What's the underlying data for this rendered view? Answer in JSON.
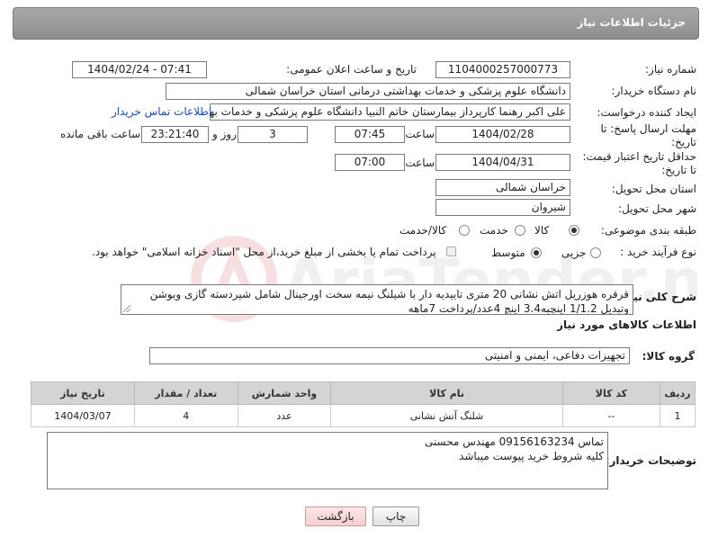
{
  "header": {
    "title": "جزئیات اطلاعات نیاز"
  },
  "form": {
    "need_number_label": "شماره نیاز:",
    "need_number": "1104000257000773",
    "announce_label": "تاریخ و ساعت اعلان عمومی:",
    "announce_value": "1404/02/24 - 07:41",
    "buyer_label": "نام دستگاه خریدار:",
    "buyer_value": "دانشگاه علوم پزشکی و خدمات بهداشتی درمانی استان خراسان شمالی",
    "creator_label": "ایجاد کننده درخواست:",
    "creator_value": "علی اکبر رهنما کارپرداز بیمارستان خاتم النبیا دانشگاه علوم پزشکی و خدمات بهداشتی",
    "contact_link": "اطلاعات تماس خریدار",
    "deadline_label_line1": "مهلت ارسال پاسخ: تا",
    "deadline_label_line2": "تاریخ:",
    "deadline_date": "1404/02/28",
    "time_label": "ساعت",
    "deadline_time": "07:45",
    "days_value": "3",
    "days_label": "روز و",
    "remaining_time": "23:21:40",
    "remaining_label": "ساعت باقی مانده",
    "validity_label_line1": "حداقل تاریخ اعتبار قیمت:",
    "validity_label_line2": "تا تاریخ:",
    "validity_date": "1404/04/31",
    "validity_time_label": "ساعت",
    "validity_time": "07:00",
    "province_label": "استان محل تحویل:",
    "province_value": "خراسان شمالی",
    "city_label": "شهر محل تحویل:",
    "city_value": "شیروان",
    "category_label": "طبقه بندی موضوعی:",
    "category_options": [
      "کالا",
      "خدمت",
      "کالا/خدمت"
    ],
    "category_selected": "کالا",
    "process_label": "نوع فرآیند خرید :",
    "process_options": [
      "جزیی",
      "متوسط"
    ],
    "process_selected": "متوسط",
    "payment_note": "پرداخت تمام یا بخشی از مبلغ خرید،از محل \"اسناد خزانه اسلامی\" خواهد بود."
  },
  "description": {
    "label": "شرح کلی نیاز:",
    "text": "قرقره هوزریل اتش نشانی 20 متری تاییدیه دار با شیلنگ نیمه سخت اورجینال شامل شیردسته گازی وبوشن وتبدیل 1/1.2 اینچبه3.4 اینچ 4عدد/پرداخت 7ماهه"
  },
  "goods": {
    "section_title": "اطلاعات کالاهای مورد نیاز",
    "group_label": "گروه کالا:",
    "group_value": "تجهیزات دفاعی، ایمنی و امنیتی",
    "columns": [
      "ردیف",
      "کد کالا",
      "نام کالا",
      "واحد شمارش",
      "تعداد / مقدار",
      "تاریخ نیاز"
    ],
    "rows": [
      [
        "1",
        "--",
        "شلنگ آتش نشانی",
        "عدد",
        "4",
        "1404/03/07"
      ]
    ]
  },
  "buyer_notes": {
    "label": "توضیحات خریدار:",
    "line1": "تماس 09156163234 مهندس محسنی",
    "line2": "کلیه شروط خرید پیوست میباشد"
  },
  "buttons": {
    "print": "چاپ",
    "back": "بازگشت"
  },
  "watermark": {
    "text": "AriaTender.neT"
  },
  "colors": {
    "header_bg": "#999999",
    "link": "#1a47c8",
    "back_button": "#f5cfcf"
  }
}
